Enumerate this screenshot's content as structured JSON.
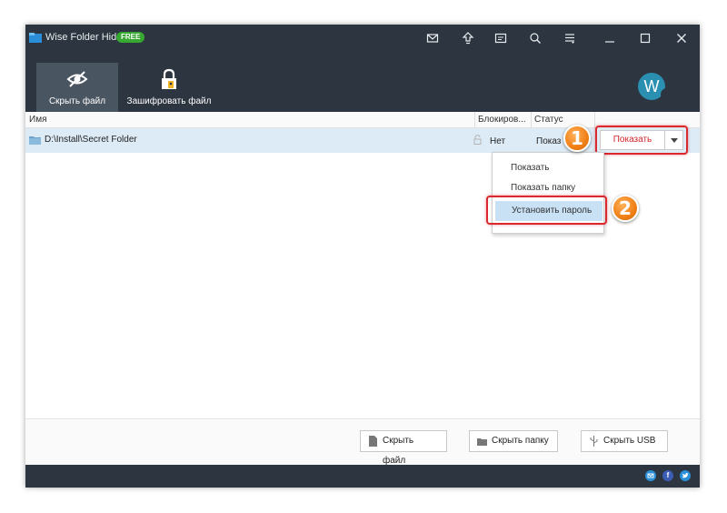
{
  "app": {
    "title": "Wise Folder Hider",
    "badge": "FREE",
    "accent": "#d9282e",
    "titlebar_color": "#2c3540"
  },
  "titlebar_icons": [
    "mail-icon",
    "upgrade-icon",
    "feedback-icon",
    "language-icon",
    "menu-icon",
    "minimize-icon",
    "maximize-icon",
    "close-icon"
  ],
  "toolbar": {
    "hide_file_label": "Скрыть файл",
    "encrypt_file_label": "Зашифровать файл",
    "avatar_letter": "W"
  },
  "table": {
    "columns": {
      "name": "Имя",
      "locked": "Блокиров...",
      "status": "Статус",
      "operation": ""
    },
    "rows": [
      {
        "path": "D:\\Install\\Secret Folder",
        "locked": "Нет",
        "status": "Показ",
        "action": "Показать"
      }
    ]
  },
  "dropdown": {
    "items": [
      "Показать",
      "Показать папку",
      "Установить пароль"
    ],
    "selected_index": 2
  },
  "annotations": {
    "step1": "1",
    "step2": "2"
  },
  "bottom": {
    "hide_file": "Скрыть файл",
    "hide_folder": "Скрыть папку",
    "hide_usb": "Скрыть USB"
  },
  "social": {
    "facebook": "f"
  }
}
